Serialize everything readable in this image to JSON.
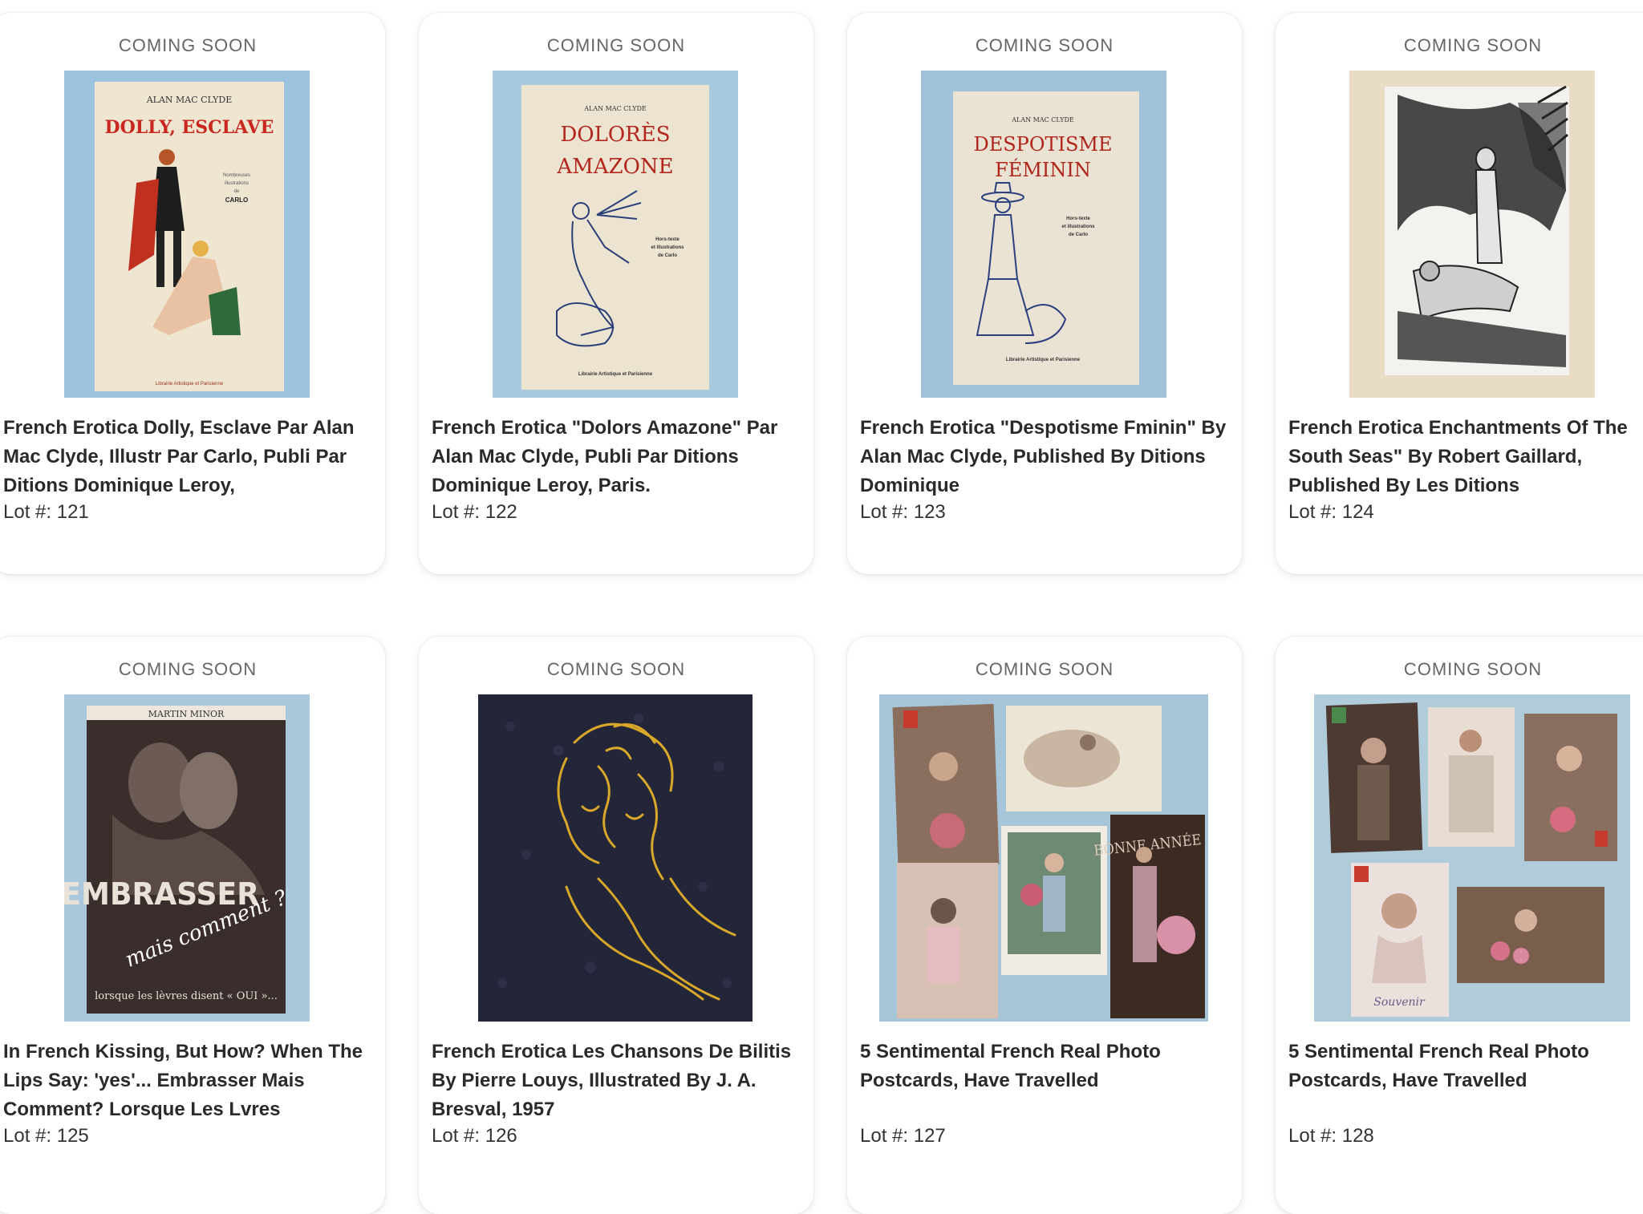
{
  "lots": [
    {
      "status": "COMING SOON",
      "title": "French Erotica Dolly, Esclave Par Alan Mac Clyde, Illustr Par Carlo, Publi Par Ditions Dominique Leroy,",
      "lot_label": "Lot #: 121",
      "image": {
        "author": "ALAN MAC CLYDE",
        "cover_title": "DOLLY, ESCLAVE",
        "cover_lines": [
          "Nombreuses",
          "illustrations",
          "de",
          "CARLO"
        ],
        "publisher": "Librairie Artistique et Parisienne"
      }
    },
    {
      "status": "COMING SOON",
      "title": "French Erotica \"Dolors Amazone\" Par Alan Mac Clyde, Publi Par Ditions Dominique Leroy, Paris.",
      "lot_label": "Lot #: 122",
      "image": {
        "author": "ALAN MAC CLYDE",
        "cover_title_1": "DOLORÈS",
        "cover_title_2": "AMAZONE",
        "cover_lines": [
          "Hors-texte",
          "et illustrations",
          "de Carlo"
        ],
        "publisher": "Librairie Artistique et Parisienne"
      }
    },
    {
      "status": "COMING SOON",
      "title": "French Erotica \"Despotisme Fminin\" By Alan Mac Clyde, Published By Ditions Dominique",
      "lot_label": "Lot #: 123",
      "image": {
        "author": "ALAN MAC CLYDE",
        "cover_title_1": "DESPOTISME",
        "cover_title_2": "FÉMININ",
        "cover_lines": [
          "Hors-texte",
          "et illustrations",
          "de Carlo"
        ],
        "publisher": "Librairie Artistique et Parisienne"
      }
    },
    {
      "status": "COMING SOON",
      "title": "French Erotica Enchantments Of The South Seas\" By Robert Gaillard, Published By Les Ditions",
      "lot_label": "Lot #: 124",
      "image": {}
    },
    {
      "status": "COMING SOON",
      "title": "In French Kissing, But How? When The Lips Say: 'yes'... Embrasser Mais Comment? Lorsque Les Lvres",
      "lot_label": "Lot #: 125",
      "image": {
        "author": "MARTIN MINOR",
        "cover_title": "EMBRASSER",
        "cover_subtitle": "mais comment ?",
        "cover_footer": "lorsque les lèvres disent « OUI »..."
      }
    },
    {
      "status": "COMING SOON",
      "title": "French Erotica Les Chansons De Bilitis By Pierre Louys, Illustrated By J. A. Bresval, 1957",
      "lot_label": "Lot #: 126",
      "image": {}
    },
    {
      "status": "COMING SOON",
      "title": "5 Sentimental French Real Photo Postcards, Have Travelled",
      "lot_label": "Lot #: 127",
      "image": {
        "card_text": "BONNE ANNÉE"
      }
    },
    {
      "status": "COMING SOON",
      "title": "5 Sentimental French Real Photo Postcards, Have Travelled",
      "lot_label": "Lot #: 128",
      "image": {
        "card_text": "Souvenir"
      }
    }
  ]
}
